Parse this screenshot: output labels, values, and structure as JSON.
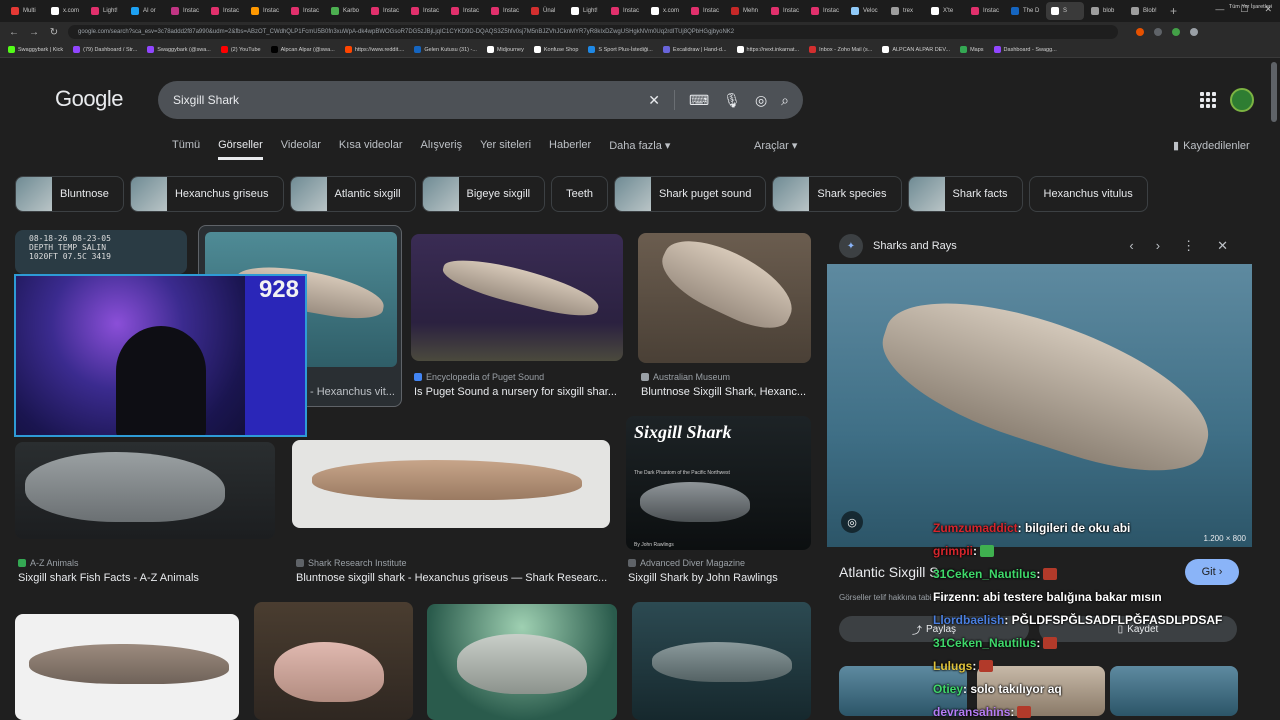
{
  "browser": {
    "tabs": [
      "Multi",
      "x.com",
      "Light!",
      "AI or",
      "Instac",
      "Instac",
      "Instac",
      "Instac",
      "Karbo",
      "Instac",
      "Instac",
      "Instac",
      "Instac",
      "Ünal",
      "Light!",
      "Instac",
      "x.com",
      "Instac",
      "Mehn",
      "Instac",
      "Instac",
      "Veloc",
      "trex",
      "X'te",
      "Instac",
      "The D",
      "S",
      "blob",
      "Blob!"
    ],
    "url": "google.com/search?sca_esv=3c78addd2f87a990&udm=2&fbs=ABzOT_CWdhQLP1FcmU5B0fn3xuWpA-dk4wpBWOGsoR7DG5zJBjLjqIC1CYKD9D-DQAQS3Z5hfv0sj7M5nBJZVhJCknMYR7yR8kIxDZwgUSHgkNVm0Uq2rdITUj8QPbHGgjbyoNK2",
    "bookmarks": [
      "Swaggybark | Kick",
      "(79) Dashboard / Str...",
      "Swaggybark (@swa...",
      "(2) YouTube",
      "Alpcan Alpar (@swa...",
      "https://www.reddit....",
      "Gelen Kutusu (31) -...",
      "Midjourney",
      "Konfuse Shop",
      "S Sport Plus-İstediği...",
      "Excalidraw | Hand-d...",
      "https://next.inkarnat...",
      "Inbox - Zoho Mail (s...",
      "ALPCAN ALPAR DEV...",
      "Maps",
      "Dashboard - Swagg..."
    ],
    "bookmarks_right": "Tüm Yer İşaretleri"
  },
  "google": {
    "logo": "Google",
    "query": "Sixgill Shark",
    "nav_tabs": [
      "Tümü",
      "Görseller",
      "Videolar",
      "Kısa videolar",
      "Alışveriş",
      "Yer siteleri",
      "Haberler",
      "Daha fazla ▾"
    ],
    "tools": "Araçlar ▾",
    "saved": "Kaydedilenler",
    "chips": [
      "Bluntnose",
      "Hexanchus griseus",
      "Atlantic sixgill",
      "Bigeye sixgill",
      "Teeth",
      "Shark puget sound",
      "Shark species",
      "Shark facts",
      "Hexanchus vitulus"
    ]
  },
  "results": [
    {
      "source": "",
      "title": "- Hexanchus vit..."
    },
    {
      "source": "Encyclopedia of Puget Sound",
      "title": "Is Puget Sound a nursery for sixgill shar..."
    },
    {
      "source": "Australian Museum",
      "title": "Bluntnose Sixgill Shark, Hexanc..."
    },
    {
      "source": "A-Z Animals",
      "title": "Sixgill shark Fish Facts - A-Z Animals"
    },
    {
      "source": "Shark Research Institute",
      "title": "Bluntnose sixgill shark - Hexanchus griseus — Shark Researc..."
    },
    {
      "source": "Advanced Diver Magazine",
      "title": "Sixgill Shark by John Rawlings"
    }
  ],
  "overlay_texts": {
    "timestamp_1": "08-18-26   08-23-05",
    "timestamp_2": "DEPTH   TEMP   SALIN",
    "timestamp_3": "1020FT  07.5C  3419",
    "book_title": "Sixgill Shark",
    "book_sub": "The Dark Phantom of the Pacific Northwest",
    "book_author": "By John Rawlings"
  },
  "webcam": {
    "counter": "928"
  },
  "panel": {
    "site": "Sharks and Rays",
    "size": "1.200 × 800",
    "caption": "Atlantic Sixgill S",
    "git": "Git ›",
    "note": "Görseller telif hakkına tabi olabilir.",
    "share": "Paylaş",
    "save": "Kaydet"
  },
  "chat": [
    {
      "user": "Zumzumaddict",
      "text": ": bilgileri de oku abi",
      "color": "#d6262d"
    },
    {
      "user": "grimpii",
      "text": ":",
      "color": "#d6262d"
    },
    {
      "user": "31Ceken_Nautilus",
      "text": ":",
      "color": "#3fd86a"
    },
    {
      "user": "Firzenn",
      "text": ": abi testere balığına bakar mısın",
      "color": "#ffffff"
    },
    {
      "user": "Llordbaelish",
      "text": ": PĞLDFSPĞLSADFLPĞFASDLPDSAF",
      "color": "#4a7fe0"
    },
    {
      "user": "31Ceken_Nautilus",
      "text": ":",
      "color": "#3fd86a"
    },
    {
      "user": "Lulugs",
      "text": ":",
      "color": "#e0c23a"
    },
    {
      "user": "Otiey",
      "text": ": solo takılıyor aq",
      "color": "#3fd86a"
    },
    {
      "user": "devransahins",
      "text": ":",
      "color": "#b57cf5"
    }
  ],
  "colors": {
    "accent": "#8ab4f8",
    "background": "#1f1f1f",
    "search_bg": "#4d5156"
  }
}
